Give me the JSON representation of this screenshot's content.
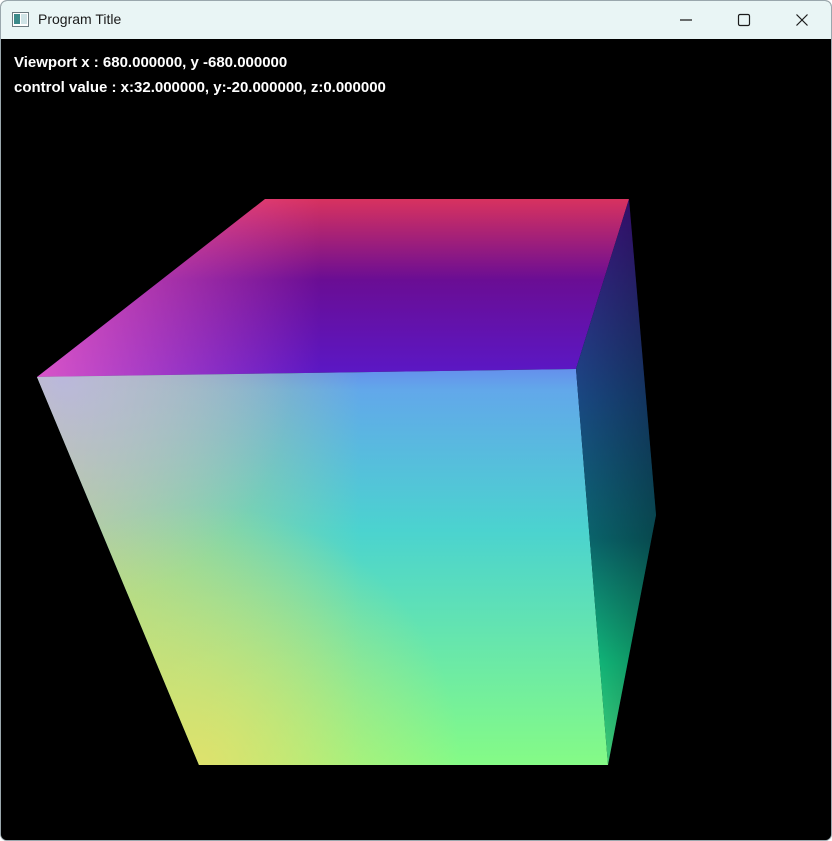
{
  "window": {
    "title": "Program Title",
    "icon": "app-window-icon",
    "controls": [
      "minimize-icon",
      "maximize-icon",
      "close-icon"
    ]
  },
  "overlay": {
    "viewport_text": "Viewport x : 680.000000, y -680.000000",
    "control_text": "control value : x:32.000000, y:-20.000000, z:0.000000"
  },
  "scene": {
    "background": "#000000",
    "object": "rgb-color-cube",
    "face_colors": {
      "top": [
        "#d8325f",
        "#a01a7a",
        "#6a0d94",
        "#5a18c8"
      ],
      "front": [
        "#a7b0ee",
        "#3aa7e0",
        "#6ef49a",
        "#d6e36c"
      ],
      "side": [
        "#3e1696",
        "#0f6a7e",
        "#14d88a"
      ]
    }
  }
}
